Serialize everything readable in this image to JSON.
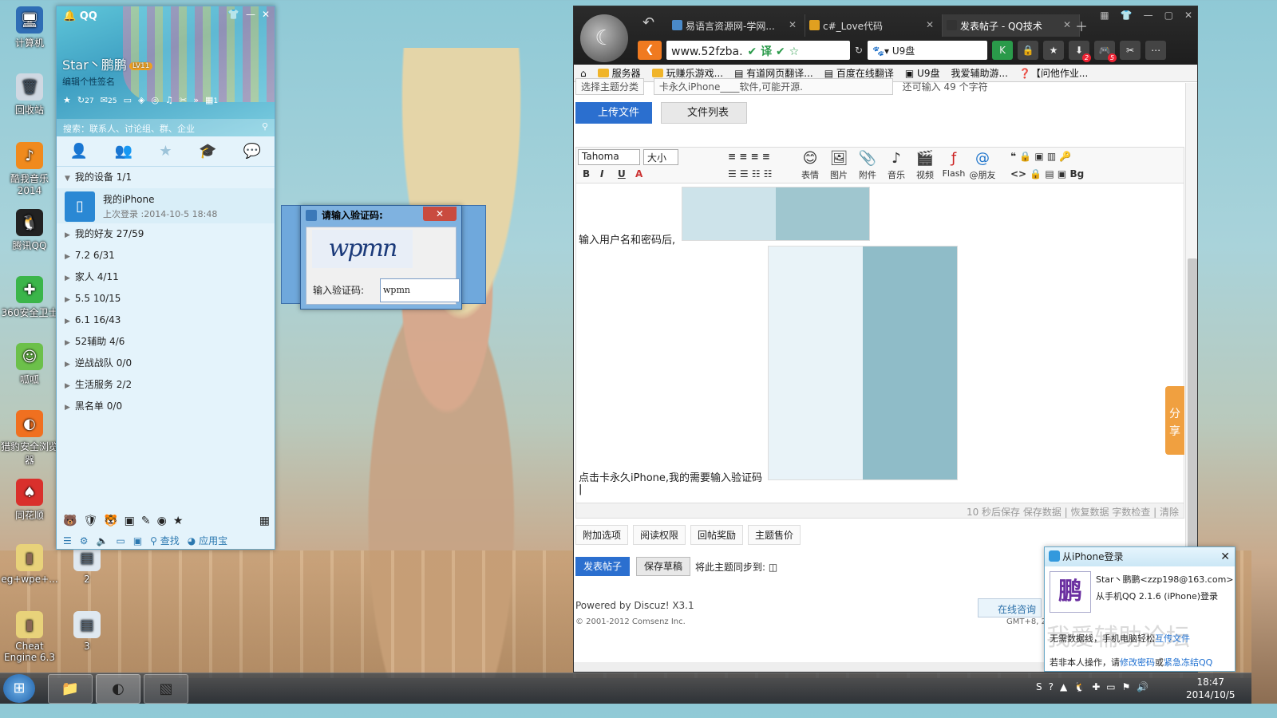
{
  "desktop": {
    "icons": [
      {
        "label": "计算机",
        "icon": "computer-icon"
      },
      {
        "label": "回收站",
        "icon": "recycle-bin-icon"
      },
      {
        "label": "酷我音乐2014",
        "icon": "kuwo-music-icon"
      },
      {
        "label": "腾讯QQ",
        "icon": "qq-penguin-icon"
      },
      {
        "label": "360安全卫士",
        "icon": "360-safe-icon"
      },
      {
        "label": "呱呱",
        "icon": "guagua-icon"
      },
      {
        "label": "猎豹安全浏览器",
        "icon": "liebao-browser-icon"
      },
      {
        "label": "同花顺",
        "icon": "tonghuashun-icon"
      },
      {
        "label": "eg+wpe+...",
        "icon": "folder-icon"
      },
      {
        "label": "2",
        "icon": "file-icon"
      },
      {
        "label": "Cheat Engine 6.3",
        "icon": "folder-icon"
      },
      {
        "label": "3",
        "icon": "file-icon"
      }
    ]
  },
  "qq": {
    "logo": "QQ",
    "nickname": "Star丶鹏鹏",
    "level_badge": "LV11",
    "signature_placeholder": "编辑个性签名",
    "badge_count_1": "27",
    "badge_count_2": "25",
    "badge_count_3": "1",
    "search_placeholder": "搜索：联系人、讨论组、群、企业",
    "groups": [
      {
        "label": "我的设备",
        "count": "1/1",
        "expanded": true
      },
      {
        "label": "我的好友",
        "count": "27/59"
      },
      {
        "label": "7.2",
        "count": "6/31"
      },
      {
        "label": "家人",
        "count": "4/11"
      },
      {
        "label": "5.5",
        "count": "10/15"
      },
      {
        "label": "6.1",
        "count": "16/43"
      },
      {
        "label": "52辅助",
        "count": "4/6"
      },
      {
        "label": "逆战战队",
        "count": "0/0"
      },
      {
        "label": "生活服务",
        "count": "2/2"
      },
      {
        "label": "黑名单",
        "count": "0/0"
      }
    ],
    "device": {
      "name": "我的iPhone",
      "last_login": "上次登录 :2014-10-5 18:48"
    },
    "bottom": {
      "find": "查找",
      "appstore": "应用宝"
    }
  },
  "captcha": {
    "title": "请输入验证码:",
    "close": "✕",
    "captcha_image_text": "wpmn",
    "label": "输入验证码:",
    "value": "wpmn"
  },
  "browser": {
    "tabs": [
      {
        "title": "易语言资源网-学网...",
        "active": false
      },
      {
        "title": "c#_Love代码",
        "active": false
      },
      {
        "title": "发表帖子 - QQ技术",
        "active": true
      }
    ],
    "url": "www.52fzba.",
    "search_value": "U9盘",
    "bookmarks": [
      "服务器",
      "玩赚乐游戏...",
      "有道网页翻译...",
      "百度在线翻译",
      "U9盘",
      "我爱辅助游...",
      "【问他作业..."
    ],
    "top_cut": {
      "type_select": "选择主题分类",
      "title_value": "卡永久iPhone____软件,可能开源.",
      "remain": "还可输入 49 个字符"
    },
    "upload_btn": "上传文件",
    "filelist_btn": "文件列表",
    "editor": {
      "font": "Tahoma",
      "size": "大小",
      "tools": [
        "表情",
        "图片",
        "附件",
        "音乐",
        "视频",
        "Flash",
        "@朋友"
      ],
      "line1": "输入用户名和密码后,",
      "line2": "点击卡永久iPhone,我的需要输入验证码",
      "savebar": "10 秒后保存 保存数据 | 恢复数据 字数检查 | 清除"
    },
    "options": [
      "附加选项",
      "阅读权限",
      "回帖奖励",
      "主题售价"
    ],
    "post_btn": "发表帖子",
    "draft_btn": "保存草稿",
    "sync_label": "将此主题同步到:",
    "powered": "Powered by Discuz! X3.1",
    "copyright": "© 2001-2012 Comsenz Inc.",
    "consult": "在线咨询",
    "gmt": "GMT+8, 20",
    "share": "分享"
  },
  "notification": {
    "title": "从iPhone登录",
    "account": "Star丶鹏鹏<zzp198@163.com>",
    "device_line": "从手机QQ 2.1.6 (iPhone)登录",
    "avatar_char": "鹏",
    "tip1_prefix": "无需数据线，手机电脑轻松",
    "tip1_link": "互传文件",
    "tip2_prefix": "若非本人操作，请",
    "tip2_link1": "修改密码",
    "tip2_mid": "或",
    "tip2_link2": "紧急冻结QQ",
    "watermark": "我爱辅助论坛"
  },
  "taskbar": {
    "time": "18:47",
    "date": "2014/10/5"
  }
}
